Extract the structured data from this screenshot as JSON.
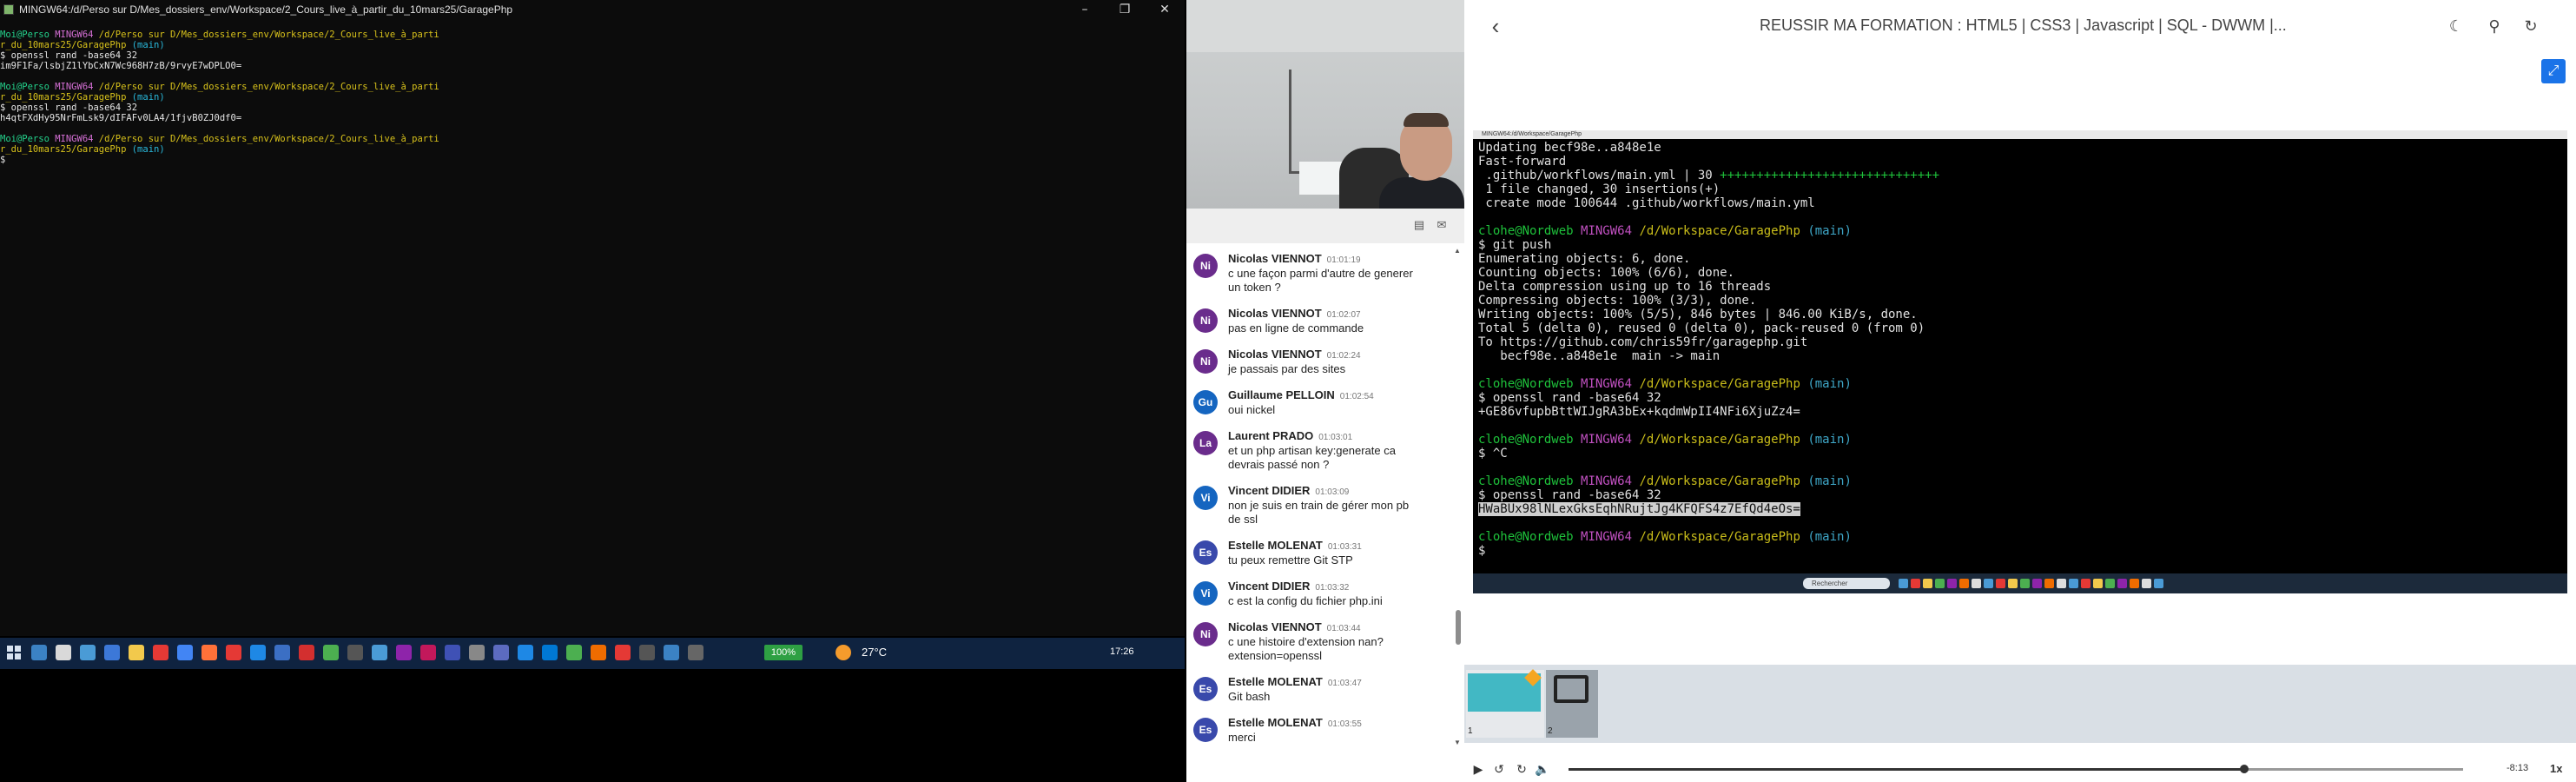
{
  "terminal": {
    "title": "MINGW64:/d/Perso sur D/Mes_dossiers_env/Workspace/2_Cours_live_à_partir_du_10mars25/GaragePhp",
    "lines": [
      [
        [
          "Moi@Perso ",
          "g"
        ],
        [
          "MINGW64 ",
          "m"
        ],
        [
          "/d/Perso sur D/Mes_dossiers_env/Workspace/2_Cours_live_à_parti",
          "y"
        ]
      ],
      [
        [
          "r_du_10mars25/GaragePhp",
          "y"
        ],
        [
          " (main)",
          "c"
        ]
      ],
      [
        [
          "$ openssl rand -base64 32",
          "w"
        ]
      ],
      [
        [
          "im9F1Fa/lsbjZ1lYbCxN7Wc968H7zB/9rvyE7wDPLO0=",
          "w"
        ]
      ],
      [
        [
          "",
          "w"
        ]
      ],
      [
        [
          "Moi@Perso ",
          "g"
        ],
        [
          "MINGW64 ",
          "m"
        ],
        [
          "/d/Perso sur D/Mes_dossiers_env/Workspace/2_Cours_live_à_parti",
          "y"
        ]
      ],
      [
        [
          "r_du_10mars25/GaragePhp",
          "y"
        ],
        [
          " (main)",
          "c"
        ]
      ],
      [
        [
          "$ openssl rand -base64 32",
          "w"
        ]
      ],
      [
        [
          "h4qtFXdHy95NrFmLsk9/dIFAFv0LA4/1fjvB0ZJ0df0=",
          "w"
        ]
      ],
      [
        [
          "",
          "w"
        ]
      ],
      [
        [
          "Moi@Perso ",
          "g"
        ],
        [
          "MINGW64 ",
          "m"
        ],
        [
          "/d/Perso sur D/Mes_dossiers_env/Workspace/2_Cours_live_à_parti",
          "y"
        ]
      ],
      [
        [
          "r_du_10mars25/GaragePhp",
          "y"
        ],
        [
          " (main)",
          "c"
        ]
      ],
      [
        [
          "$",
          "w"
        ]
      ]
    ]
  },
  "taskbar": {
    "battery": "100%",
    "weather": "27°C",
    "time": "17:26",
    "icons": [
      "#3b82c4",
      "#d9d9d9",
      "#4a9bd6",
      "#3c78d8",
      "#f2c94c",
      "#e53935",
      "#4285f4",
      "#ff7139",
      "#e53935",
      "#1e88e5",
      "#3b6fc4",
      "#d32f2f",
      "#4caf50",
      "#555",
      "#4a9bd6",
      "#8e24aa",
      "#c2185b",
      "#3f51b5",
      "#888",
      "#5c6bc0",
      "#1e88e5",
      "#0078d4",
      "#4caf50",
      "#ef6c00",
      "#e53935",
      "#555",
      "#3b82c4",
      "#666"
    ]
  },
  "chat": {
    "messages": [
      {
        "initials": "Ni",
        "color": "#6a2c8c",
        "name": "Nicolas VIENNOT",
        "time": "01:01:19",
        "lines": [
          "c une façon parmi d'autre de generer",
          "un token ?"
        ]
      },
      {
        "initials": "Ni",
        "color": "#6a2c8c",
        "name": "Nicolas VIENNOT",
        "time": "01:02:07",
        "lines": [
          "pas en ligne de commande"
        ]
      },
      {
        "initials": "Ni",
        "color": "#6a2c8c",
        "name": "Nicolas VIENNOT",
        "time": "01:02:24",
        "lines": [
          "je passais par des sites"
        ]
      },
      {
        "initials": "Gu",
        "color": "#1565c0",
        "name": "Guillaume PELLOIN",
        "time": "01:02:54",
        "lines": [
          "oui nickel"
        ]
      },
      {
        "initials": "La",
        "color": "#6a2c8c",
        "name": "Laurent PRADO",
        "time": "01:03:01",
        "lines": [
          "et un php artisan key:generate ca",
          "devrais passé non ?"
        ]
      },
      {
        "initials": "Vi",
        "color": "#1565c0",
        "name": "Vincent DIDIER",
        "time": "01:03:09",
        "lines": [
          "non je suis en train de gérer mon pb",
          "de ssl"
        ]
      },
      {
        "initials": "Es",
        "color": "#3949ab",
        "name": "Estelle MOLENAT",
        "time": "01:03:31",
        "lines": [
          "tu peux remettre Git STP"
        ]
      },
      {
        "initials": "Vi",
        "color": "#1565c0",
        "name": "Vincent DIDIER",
        "time": "01:03:32",
        "lines": [
          "c est la config du fichier php.ini"
        ]
      },
      {
        "initials": "Ni",
        "color": "#6a2c8c",
        "name": "Nicolas VIENNOT",
        "time": "01:03:44",
        "lines": [
          "c une histoire d'extension nan?",
          "extension=openssl"
        ]
      },
      {
        "initials": "Es",
        "color": "#3949ab",
        "name": "Estelle MOLENAT",
        "time": "01:03:47",
        "lines": [
          "Git bash"
        ]
      },
      {
        "initials": "Es",
        "color": "#3949ab",
        "name": "Estelle MOLENAT",
        "time": "01:03:55",
        "lines": [
          "merci"
        ]
      }
    ]
  },
  "player": {
    "title": "REUSSIR MA FORMATION : HTML5 | CSS3 | Javascript | SQL - DWWM |...",
    "screen_title": "MINGW64:/d/Workspace/GaragePhp",
    "screen_search": "Rechercher",
    "screen_lines": [
      [
        [
          "Updating becf98e..a848e1e",
          "w"
        ]
      ],
      [
        [
          "Fast-forward",
          "w"
        ]
      ],
      [
        [
          " .github/workflows/main.yml | 30 ",
          "w"
        ],
        [
          "++++++++++++++++++++++++++++++",
          "g"
        ]
      ],
      [
        [
          " 1 file changed, 30 insertions(+)",
          "w"
        ]
      ],
      [
        [
          " create mode 100644 .github/workflows/main.yml",
          "w"
        ]
      ],
      [
        [
          "",
          "w"
        ]
      ],
      [
        [
          "clohe@Nordweb ",
          "g"
        ],
        [
          "MINGW64 ",
          "m"
        ],
        [
          "/d/Workspace/GaragePhp",
          "y"
        ],
        [
          " (main)",
          "c"
        ]
      ],
      [
        [
          "$ git push",
          "w"
        ]
      ],
      [
        [
          "Enumerating objects: 6, done.",
          "w"
        ]
      ],
      [
        [
          "Counting objects: 100% (6/6), done.",
          "w"
        ]
      ],
      [
        [
          "Delta compression using up to 16 threads",
          "w"
        ]
      ],
      [
        [
          "Compressing objects: 100% (3/3), done.",
          "w"
        ]
      ],
      [
        [
          "Writing objects: 100% (5/5), 846 bytes | 846.00 KiB/s, done.",
          "w"
        ]
      ],
      [
        [
          "Total 5 (delta 0), reused 0 (delta 0), pack-reused 0 (from 0)",
          "w"
        ]
      ],
      [
        [
          "To https://github.com/chris59fr/garagephp.git",
          "w"
        ]
      ],
      [
        [
          "   becf98e..a848e1e  main -> main",
          "w"
        ]
      ],
      [
        [
          "",
          "w"
        ]
      ],
      [
        [
          "clohe@Nordweb ",
          "g"
        ],
        [
          "MINGW64 ",
          "m"
        ],
        [
          "/d/Workspace/GaragePhp",
          "y"
        ],
        [
          " (main)",
          "c"
        ]
      ],
      [
        [
          "$ openssl rand -base64 32",
          "w"
        ]
      ],
      [
        [
          "+GE86vfupbBttWIJgRA3bEx+kqdmWpII4NFi6XjuZz4=",
          "w"
        ]
      ],
      [
        [
          "",
          "w"
        ]
      ],
      [
        [
          "clohe@Nordweb ",
          "g"
        ],
        [
          "MINGW64 ",
          "m"
        ],
        [
          "/d/Workspace/GaragePhp",
          "y"
        ],
        [
          " (main)",
          "c"
        ]
      ],
      [
        [
          "$ ^C",
          "w"
        ]
      ],
      [
        [
          "",
          "w"
        ]
      ],
      [
        [
          "clohe@Nordweb ",
          "g"
        ],
        [
          "MINGW64 ",
          "m"
        ],
        [
          "/d/Workspace/GaragePhp",
          "y"
        ],
        [
          " (main)",
          "c"
        ]
      ],
      [
        [
          "$ openssl rand -base64 32",
          "w"
        ]
      ],
      [
        [
          "HWaBUx98lNLexGksEqhNRujtJg4KFQFS4z7EfQd4eOs=",
          "sel"
        ]
      ],
      [
        [
          "",
          "w"
        ]
      ],
      [
        [
          "clohe@Nordweb ",
          "g"
        ],
        [
          "MINGW64 ",
          "m"
        ],
        [
          "/d/Workspace/GaragePhp",
          "y"
        ],
        [
          " (main)",
          "c"
        ]
      ],
      [
        [
          "$",
          "w"
        ]
      ]
    ],
    "thumb_labels": [
      "1",
      "2"
    ],
    "time_left": "-8:13",
    "speed": "1x",
    "progress": 0.755
  },
  "colors": {
    "terminal_bg": "#0c0c0c",
    "taskbar_bg": "#0f2340",
    "accent": "#1a73e8"
  }
}
